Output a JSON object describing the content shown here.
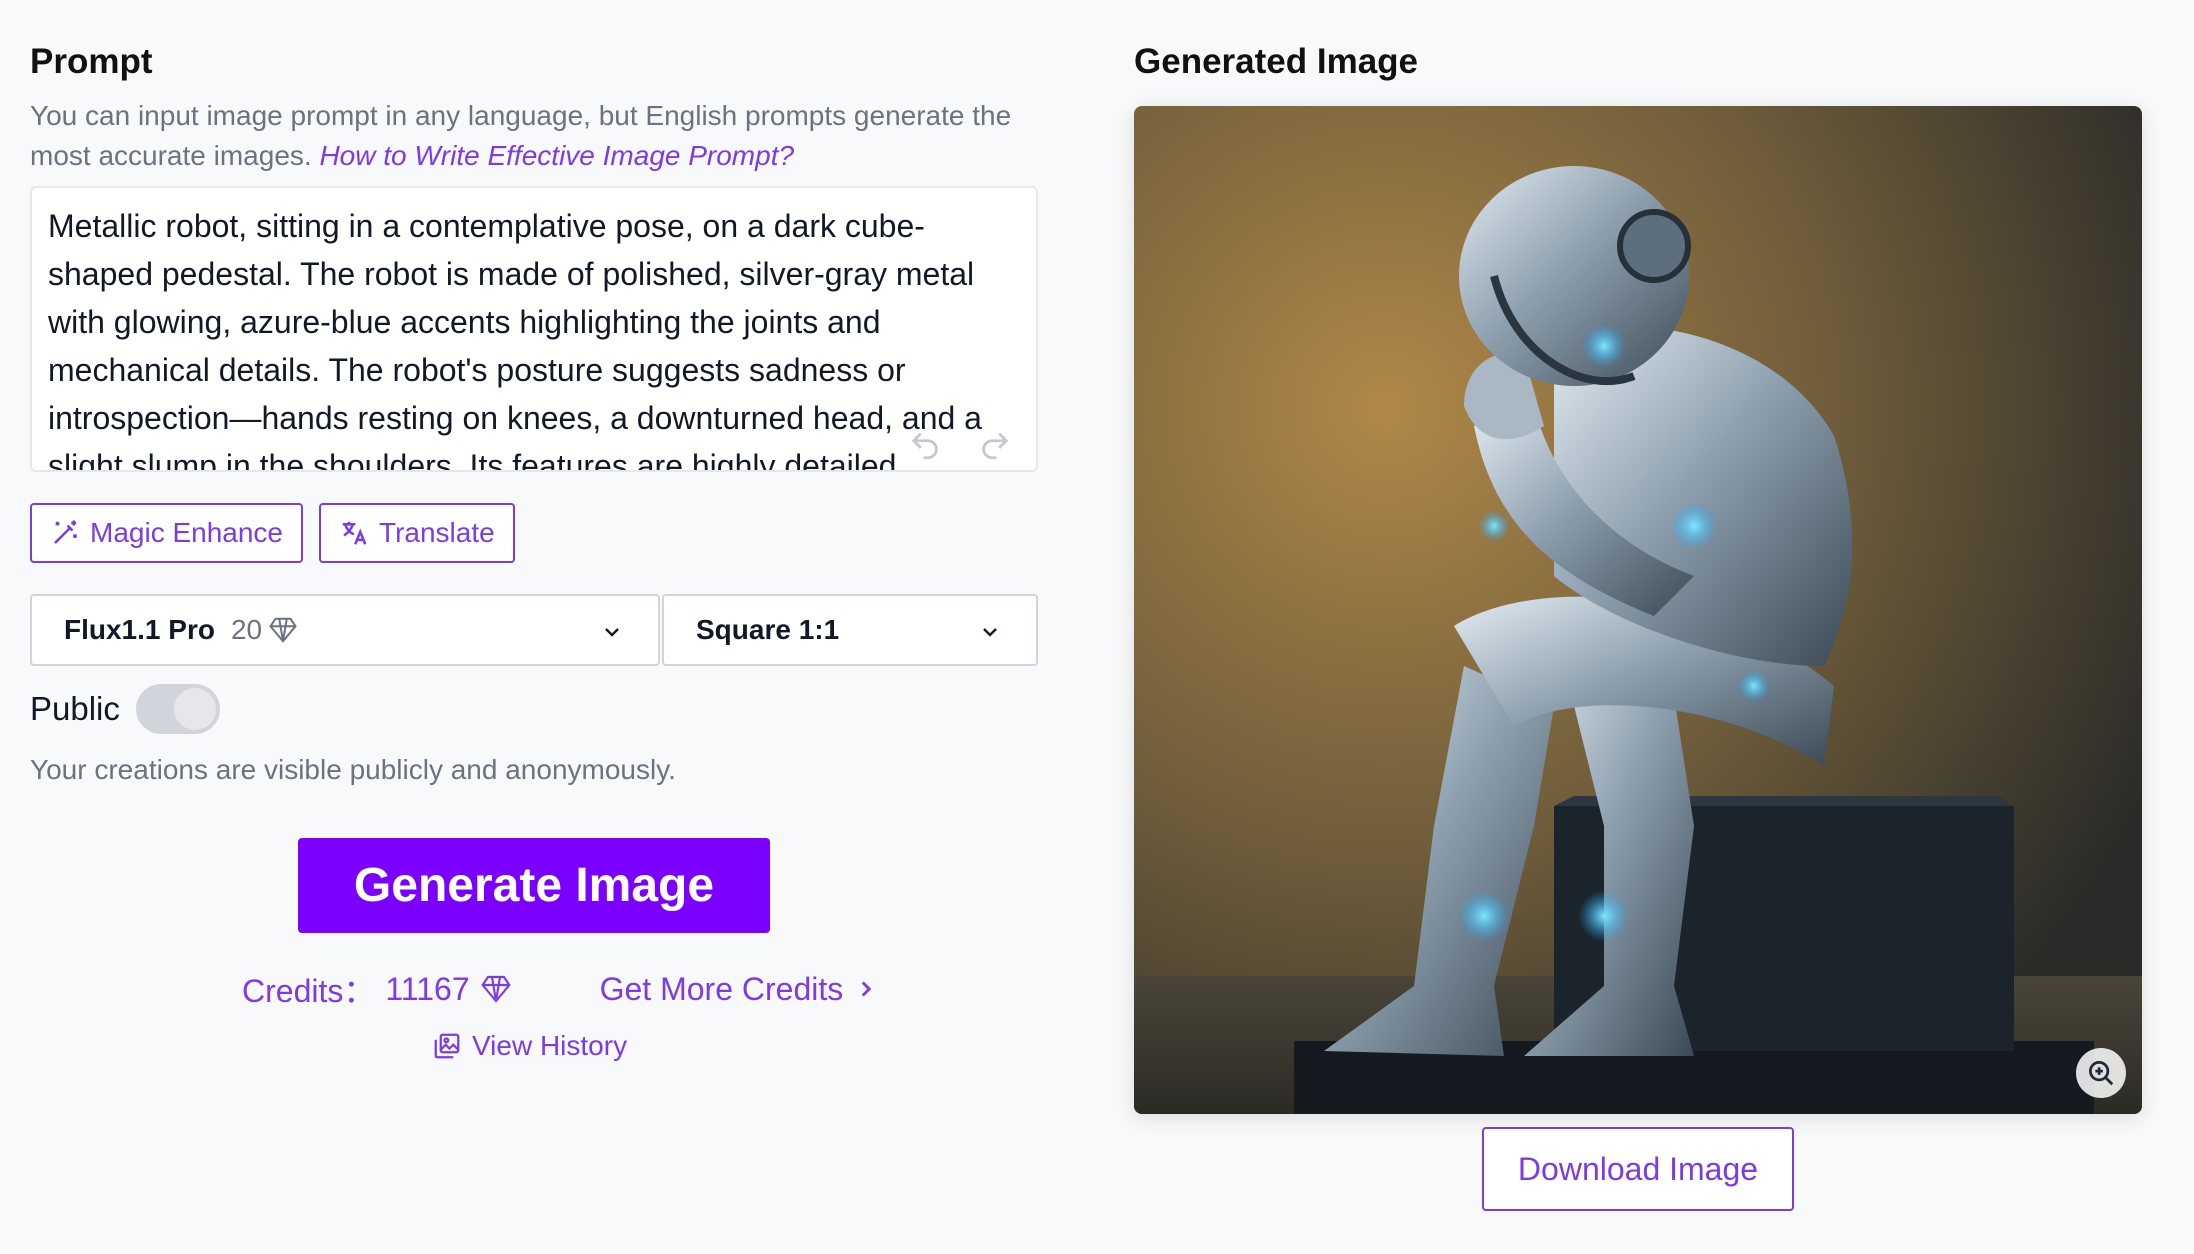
{
  "prompt": {
    "heading": "Prompt",
    "hint": "You can input image prompt in any language, but English prompts generate the most accurate images.",
    "hint_link": "How to Write Effective Image Prompt?",
    "text": "Metallic robot, sitting in a contemplative pose,  on a dark cube-shaped pedestal.  The robot is made of polished, silver-gray metal with glowing, azure-blue accents highlighting the joints and mechanical details.  The robot's posture suggests sadness or introspection—hands resting on knees, a downturned head, and a slight slump in the shoulders.  Its features are highly detailed"
  },
  "actions": {
    "magic_enhance": "Magic Enhance",
    "translate": "Translate"
  },
  "model_select": {
    "value": "Flux1.1 Pro",
    "cost": "20"
  },
  "ratio_select": {
    "value": "Square 1:1"
  },
  "public": {
    "label": "Public",
    "enabled": false,
    "description": "Your creations are visible publicly and anonymously."
  },
  "generate_label": "Generate Image",
  "credits": {
    "label": "Credits：",
    "value": "11167",
    "get_more": "Get More Credits"
  },
  "history_label": "View History",
  "result": {
    "heading": "Generated Image",
    "download_label": "Download Image"
  },
  "colors": {
    "accent": "#7c3aed",
    "primary": "#7c00ff"
  },
  "icons": [
    "magic-wand-icon",
    "translate-icon",
    "diamond-icon",
    "chevron-down-icon",
    "undo-icon",
    "redo-icon",
    "chevron-right-icon",
    "gallery-icon",
    "zoom-in-icon"
  ]
}
